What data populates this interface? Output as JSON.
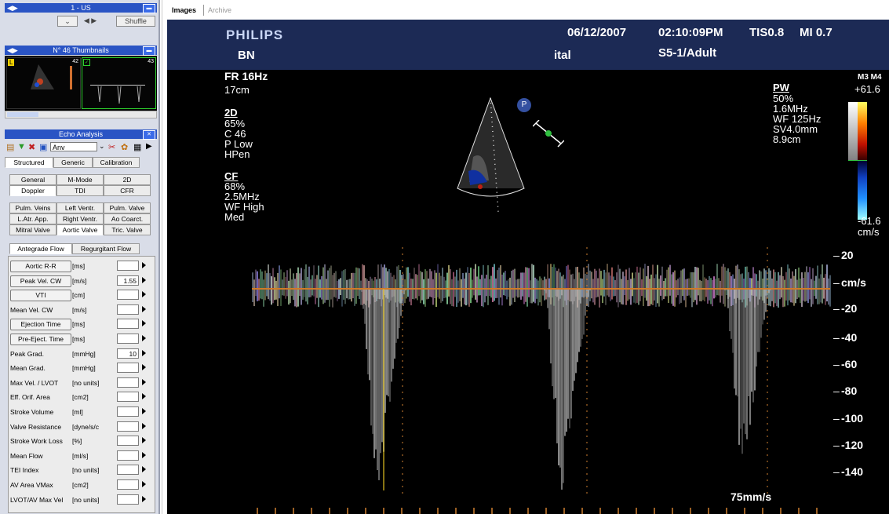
{
  "top_panel": {
    "title": "1 - US",
    "shuffle_label": "Shuffle"
  },
  "thumbnails": {
    "title": "N° 46 Thumbnails",
    "thumb1_badge": "L",
    "thumb1_num": "42",
    "thumb2_num": "43"
  },
  "echo": {
    "title": "Echo Analysis",
    "dropdown_value": "Anv",
    "tabs_main": [
      "Structured",
      "Generic",
      "Calibration"
    ],
    "tabs_mode": [
      "General",
      "M-Mode",
      "2D",
      "Doppler",
      "TDI",
      "CFR"
    ],
    "tabs_site": [
      "Pulm. Veins",
      "Left Ventr.",
      "Pulm. Valve",
      "L.Atr. App.",
      "Right Ventr.",
      "Ao Coarct.",
      "Mitral Valve",
      "Aortic Valve",
      "Tric. Valve"
    ],
    "tabs_flow": [
      "Antegrade Flow",
      "Regurgitant Flow"
    ],
    "measurements": [
      {
        "label": "Aortic R-R",
        "unit": "[ms]",
        "value": "",
        "button": true
      },
      {
        "label": "Peak Vel. CW",
        "unit": "[m/s]",
        "value": "1.55",
        "button": true
      },
      {
        "label": "VTI",
        "unit": "[cm]",
        "value": "",
        "button": true
      },
      {
        "label": "Mean Vel. CW",
        "unit": "[m/s]",
        "value": "",
        "button": false
      },
      {
        "label": "Ejection Time",
        "unit": "[ms]",
        "value": "",
        "button": true
      },
      {
        "label": "Pre-Eject. Time",
        "unit": "[ms]",
        "value": "",
        "button": true
      },
      {
        "label": "Peak Grad.",
        "unit": "[mmHg]",
        "value": "10",
        "button": false
      },
      {
        "label": "Mean Grad.",
        "unit": "[mmHg]",
        "value": "",
        "button": false
      },
      {
        "label": "Max Vel. / LVOT",
        "unit": "[no units]",
        "value": "",
        "button": false
      },
      {
        "label": "Eff. Orif. Area",
        "unit": "[cm2]",
        "value": "",
        "button": false
      },
      {
        "label": "Stroke Volume",
        "unit": "[ml]",
        "value": "",
        "button": false
      },
      {
        "label": "Valve Resistance",
        "unit": "[dyne/s/c",
        "value": "",
        "button": false
      },
      {
        "label": "Stroke Work Loss",
        "unit": "[%]",
        "value": "",
        "button": false
      },
      {
        "label": "Mean Flow",
        "unit": "[ml/s]",
        "value": "",
        "button": false
      },
      {
        "label": "TEI Index",
        "unit": "[no units]",
        "value": "",
        "button": false
      },
      {
        "label": "AV Area VMax",
        "unit": "[cm2]",
        "value": "",
        "button": false
      },
      {
        "label": "LVOT/AV Max Vel",
        "unit": "[no units]",
        "value": "",
        "button": false
      }
    ]
  },
  "viewer_tabs": {
    "images": "Images",
    "archive": "Archive"
  },
  "ultrasound": {
    "brand": "PHILIPS",
    "date": "06/12/2007",
    "time": "02:10:09PM",
    "tis": "TIS0.8",
    "mi": "MI 0.7",
    "patient": "BN",
    "institution": "ital",
    "probe": "S5-1/Adult",
    "fr": "FR 16Hz",
    "depth": "17cm",
    "left_params": [
      "65%",
      "C 46",
      "P Low",
      "HPen"
    ],
    "left_params_cf": [
      "68%",
      "2.5MHz",
      "WF High",
      "Med"
    ],
    "label_2d": "2D",
    "label_cf": "CF",
    "pw_label": "PW",
    "pw_params": [
      "50%",
      "1.6MHz",
      "WF 125Hz",
      "SV4.0mm",
      "8.9cm"
    ],
    "colorbar_label": "M3 M4",
    "colorbar_max": "+61.6",
    "colorbar_min": "-61.6",
    "colorbar_unit": "cm/s",
    "marker_p": "P",
    "scale_labels": [
      "20",
      "cm/s",
      "-20",
      "-40",
      "-60",
      "-80",
      "-100",
      "-120",
      "-140"
    ],
    "sweep_speed": "75mm/s"
  }
}
